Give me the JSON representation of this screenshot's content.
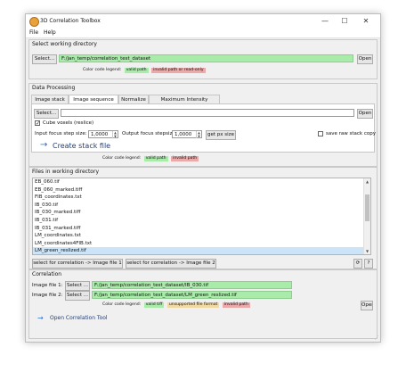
{
  "window": {
    "title": "3D Correlation Toolbox",
    "controls": {
      "minimize": "—",
      "maximize": "☐",
      "close": "✕"
    }
  },
  "menu": {
    "file": "File",
    "help": "Help"
  },
  "working_directory": {
    "section_title": "Select working directory",
    "select_label": "Select...",
    "path": "F:/jan_temp/correlation_test_dataset",
    "open_label": "Open",
    "legend_label": "Color code legend:",
    "legend_valid": "valid path",
    "legend_invalid": "invalid path or read-only"
  },
  "processing": {
    "section_title": "Data Processing",
    "tabs": [
      "Image stack",
      "Image sequence",
      "Normalize",
      "Maximum Intensity Projection"
    ],
    "active_tab": 1,
    "select_label": "Select...",
    "path": "",
    "open_label": "Open",
    "cube_voxels_label": "Cube voxels (reslice)",
    "cube_voxels_checked": true,
    "input_step_label": "Input focus step size:",
    "input_step_value": "1,0000",
    "output_step_label": "Output focus stepsize:",
    "output_step_value": "1,0000",
    "get_px_label": "get px size",
    "save_raw_label": "save raw stack copy",
    "save_raw_checked": false,
    "create_label": "Create stack file",
    "legend_label": "Color code legend:",
    "legend_valid": "valid path",
    "legend_invalid": "invalid path"
  },
  "files": {
    "section_title": "Files in working directory",
    "items": [
      "EB_060.tif",
      "EB_060_marked.tiff",
      "FIB_coordinates.txt",
      "IB_030.tif",
      "IB_030_marked.tiff",
      "IB_031.tif",
      "IB_031_marked.tiff",
      "LM_coordinates.txt",
      "LM_coordinates4FIB.txt",
      "LM_green_reslized.tif"
    ],
    "selected_index": 9,
    "select_image1_label": "select for correlation -> Image file 1",
    "select_image2_label": "select for correlation -> Image file 2",
    "refresh_glyph": "⟳",
    "help_glyph": "?"
  },
  "correlation": {
    "section_title": "Correlation",
    "image1_label": "Image file 1:",
    "image2_label": "Image file 2:",
    "select_label": "Select ...",
    "image1_path": "F:/jan_temp/correlation_test_dataset/IB_030.tif",
    "image2_path": "F:/jan_temp/correlation_test_dataset/LM_green_reslized.tif",
    "open_label": "Open",
    "legend_label": "Color code legend:",
    "legend_valid": "valid tiff",
    "legend_unsupported": "unsupported file format",
    "legend_invalid": "invalid path",
    "open_tool_label": "Open Correlation Tool"
  },
  "colors": {
    "valid": "#a9eba9",
    "invalid": "#eca9a9",
    "unsupported": "#f1d9a3",
    "selection": "#cce4f7",
    "accent": "#2a6fd6"
  }
}
